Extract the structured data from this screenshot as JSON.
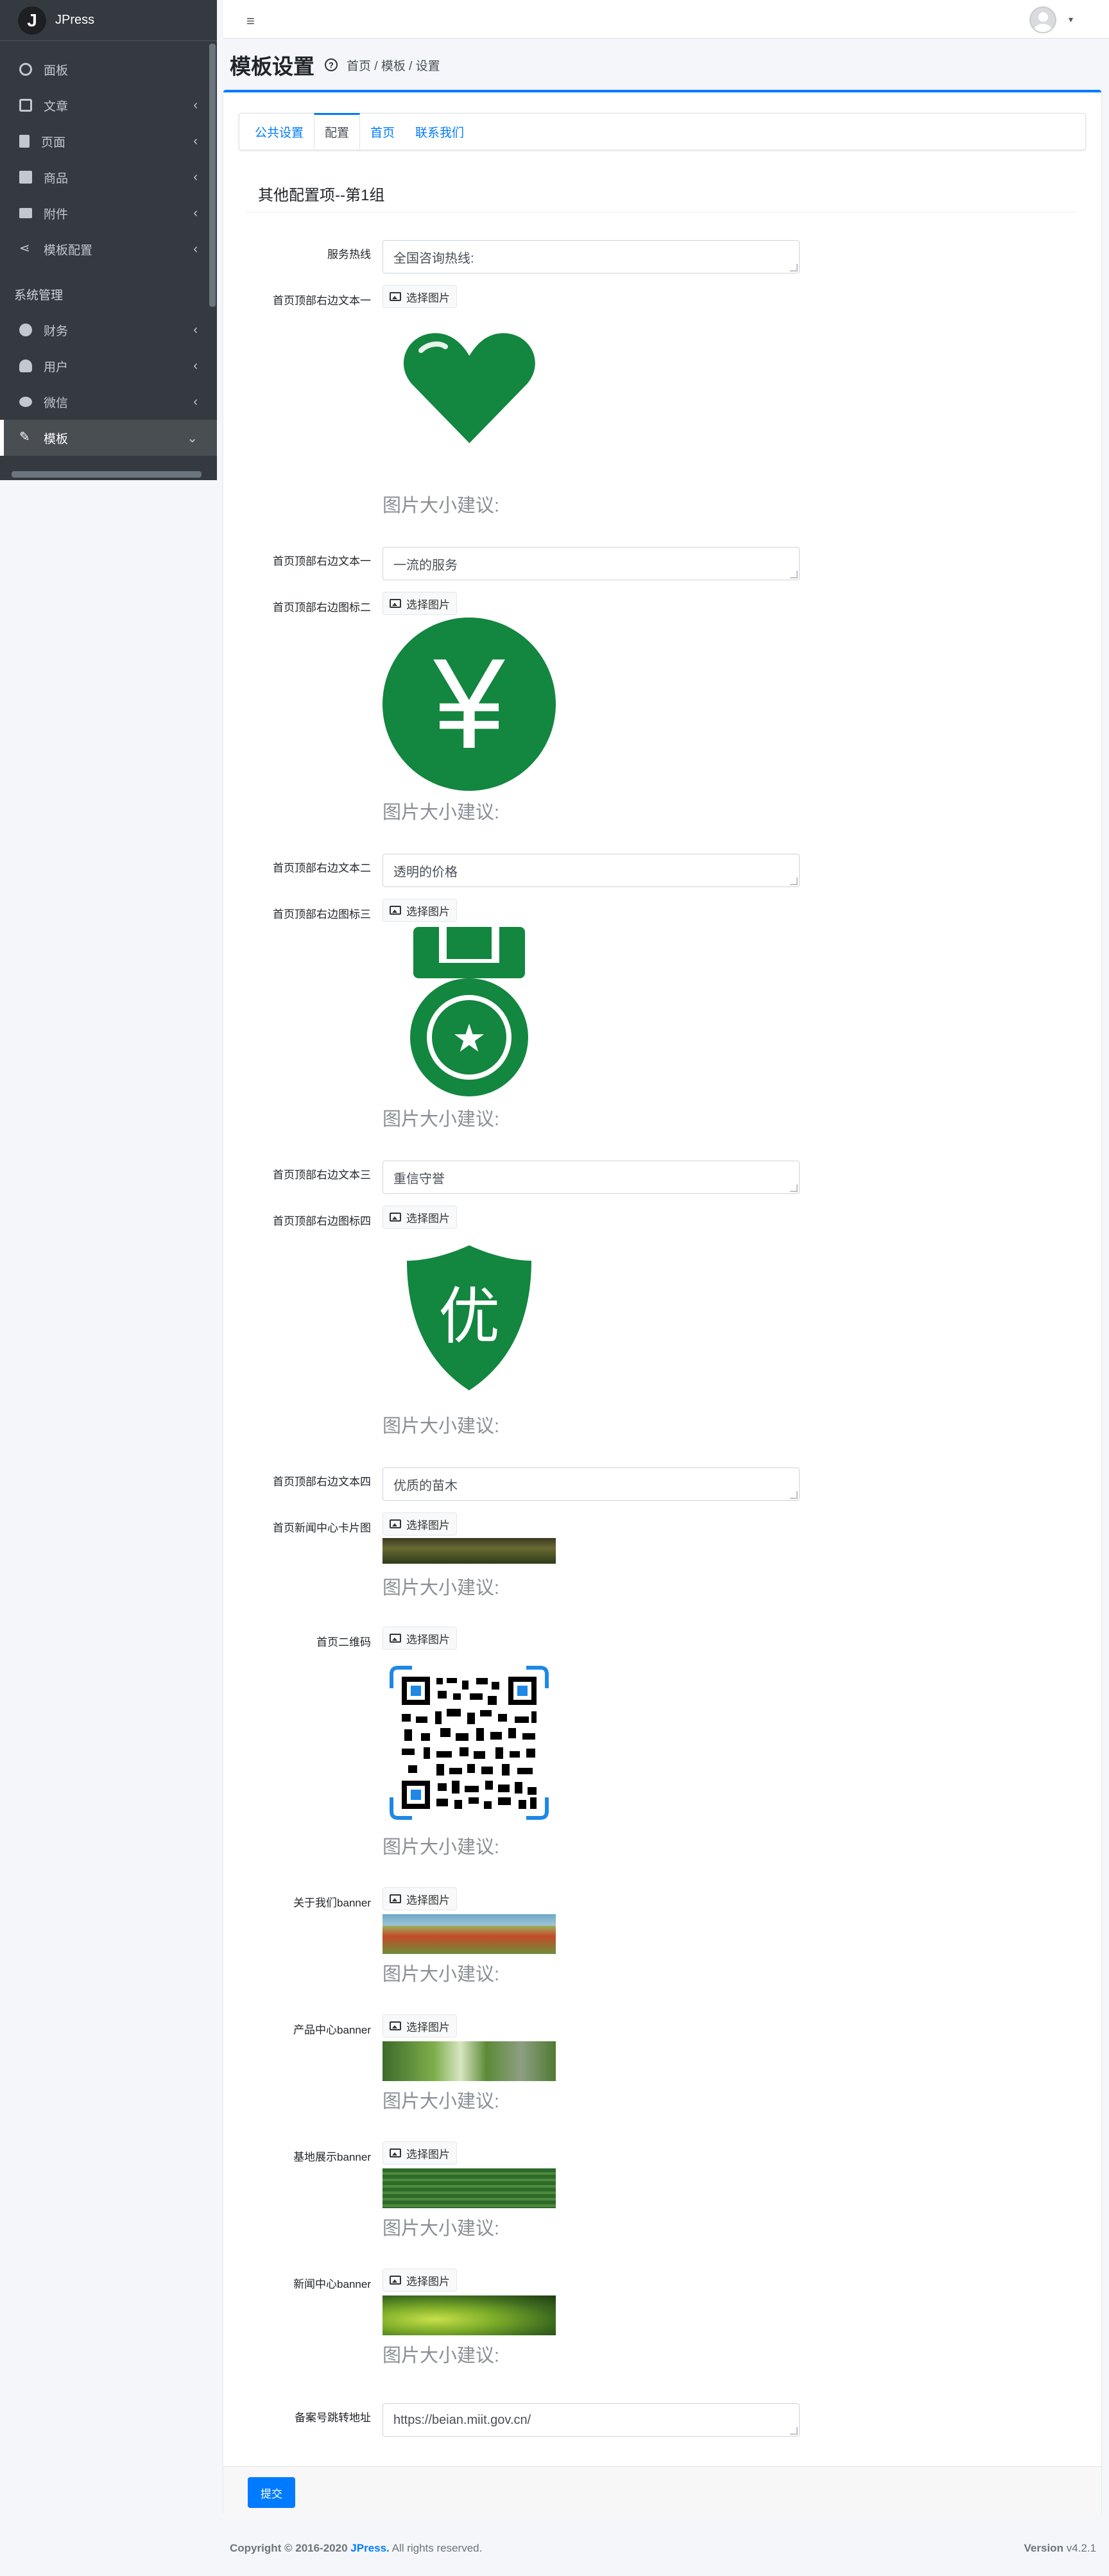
{
  "brand": {
    "logo": "J",
    "name": "JPress"
  },
  "sidebar": {
    "items": [
      {
        "label": "面板",
        "icon": "dashboard-icon",
        "chevron": ""
      },
      {
        "label": "文章",
        "icon": "edit-icon",
        "chevron": "‹"
      },
      {
        "label": "页面",
        "icon": "file-icon",
        "chevron": "‹"
      },
      {
        "label": "商品",
        "icon": "shop-icon",
        "chevron": "‹"
      },
      {
        "label": "附件",
        "icon": "folder-icon",
        "chevron": "‹"
      },
      {
        "label": "模板配置",
        "icon": "share-icon",
        "chevron": "‹"
      }
    ],
    "header": "系统管理",
    "system_items": [
      {
        "label": "财务",
        "icon": "money-icon",
        "chevron": "‹"
      },
      {
        "label": "用户",
        "icon": "user-icon",
        "chevron": "‹"
      },
      {
        "label": "微信",
        "icon": "wechat-icon",
        "chevron": "‹"
      },
      {
        "label": "模板",
        "icon": "tools-icon",
        "chevron": "⌄"
      }
    ]
  },
  "topbar": {
    "menu_glyph": "≡",
    "caret": "▾"
  },
  "header": {
    "title": "模板设置",
    "help": "?",
    "breadcrumb": "首页 / 模板 / 设置"
  },
  "tabs": [
    {
      "label": "公共设置",
      "active": false
    },
    {
      "label": "配置",
      "active": true
    },
    {
      "label": "首页",
      "active": false
    },
    {
      "label": "联系我们",
      "active": false
    }
  ],
  "section_title": "其他配置项--第1组",
  "pick_label": "选择图片",
  "size_hint": "图片大小建议:",
  "fields": {
    "hotline_label": "服务热线",
    "hotline_value": "全国咨询热线:",
    "icon1_label": "首页顶部右边文本一",
    "text1_label": "首页顶部右边文本一",
    "text1_value": "一流的服务",
    "icon2_label": "首页顶部右边图标二",
    "text2_label": "首页顶部右边文本二",
    "text2_value": "透明的价格",
    "icon3_label": "首页顶部右边图标三",
    "text3_label": "首页顶部右边文本三",
    "text3_value": "重信守誉",
    "icon4_label": "首页顶部右边图标四",
    "text4_label": "首页顶部右边文本四",
    "text4_value": "优质的苗木",
    "news_card_label": "首页新闻中心卡片图",
    "qr_label": "首页二维码",
    "about_banner_label": "关于我们banner",
    "product_banner_label": "产品中心banner",
    "base_banner_label": "基地展示banner",
    "news_banner_label": "新闻中心banner",
    "icp_label": "备案号跳转地址",
    "icp_value": "https://beian.miit.gov.cn/"
  },
  "icon_glyphs": {
    "yen": "¥",
    "star": "★",
    "you": "优"
  },
  "colors": {
    "primary": "#007bff",
    "icon_green": "#13863f",
    "sidebar": "#343a40"
  },
  "submit_label": "提交",
  "footer": {
    "copyright": "Copyright © 2016-2020",
    "brand": "JPress.",
    "rights": "All rights reserved.",
    "version_label": "Version",
    "version": "v4.2.1"
  }
}
